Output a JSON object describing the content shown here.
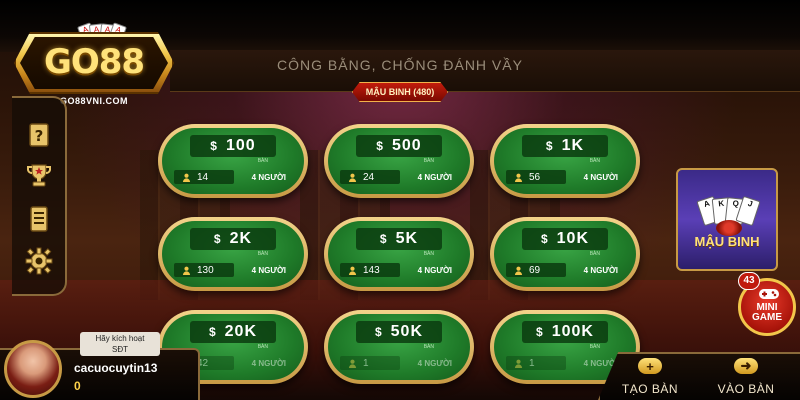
{
  "brand": {
    "logo_text": "GO88",
    "site": "GO88VNI.COM"
  },
  "header": {
    "slogan": "CÔNG BẰNG, CHỐNG ĐÁNH VẦY",
    "game_tag": "MẬU BINH (480)"
  },
  "side_menu": {
    "items": [
      {
        "name": "help",
        "icon": "help-question-icon"
      },
      {
        "name": "ranking",
        "icon": "trophy-icon"
      },
      {
        "name": "history",
        "icon": "document-icon"
      },
      {
        "name": "settings",
        "icon": "gear-icon"
      }
    ]
  },
  "tables": [
    {
      "bet": "100",
      "players": "14",
      "ban_label": "BÀN",
      "capacity": "4 NGƯỜI"
    },
    {
      "bet": "500",
      "players": "24",
      "ban_label": "BÀN",
      "capacity": "4 NGƯỜI"
    },
    {
      "bet": "1K",
      "players": "56",
      "ban_label": "BÀN",
      "capacity": "4 NGƯỜI"
    },
    {
      "bet": "2K",
      "players": "130",
      "ban_label": "BÀN",
      "capacity": "4 NGƯỜI"
    },
    {
      "bet": "5K",
      "players": "143",
      "ban_label": "BÀN",
      "capacity": "4 NGƯỜI"
    },
    {
      "bet": "10K",
      "players": "69",
      "ban_label": "BÀN",
      "capacity": "4 NGƯỜI"
    },
    {
      "bet": "20K",
      "players": "42",
      "ban_label": "BÀN",
      "capacity": "4 NGƯỜI"
    },
    {
      "bet": "50K",
      "players": "1",
      "ban_label": "BÀN",
      "capacity": "4 NGƯỜI"
    },
    {
      "bet": "100K",
      "players": "1",
      "ban_label": "BÀN",
      "capacity": "4 NGƯỜI"
    }
  ],
  "currency_symbol": "$",
  "mau_binh_card": {
    "label": "MẬU BINH",
    "cards": [
      "A",
      "K",
      "Q",
      "J"
    ]
  },
  "mini_game": {
    "badge": "43",
    "label_line1": "MINI",
    "label_line2": "GAME"
  },
  "user": {
    "activate_prompt_line1": "Hãy kích hoạt",
    "activate_prompt_line2": "SĐT",
    "username": "cacuocuytin13",
    "balance": "0"
  },
  "actions": {
    "create_table": "TẠO BÀN",
    "join_table": "VÀO BÀN"
  },
  "colors": {
    "felt": "#1f7b29",
    "rim_gold": "#c79a45",
    "accent_red": "#c21c0c",
    "balance_gold": "#ffd24a"
  }
}
